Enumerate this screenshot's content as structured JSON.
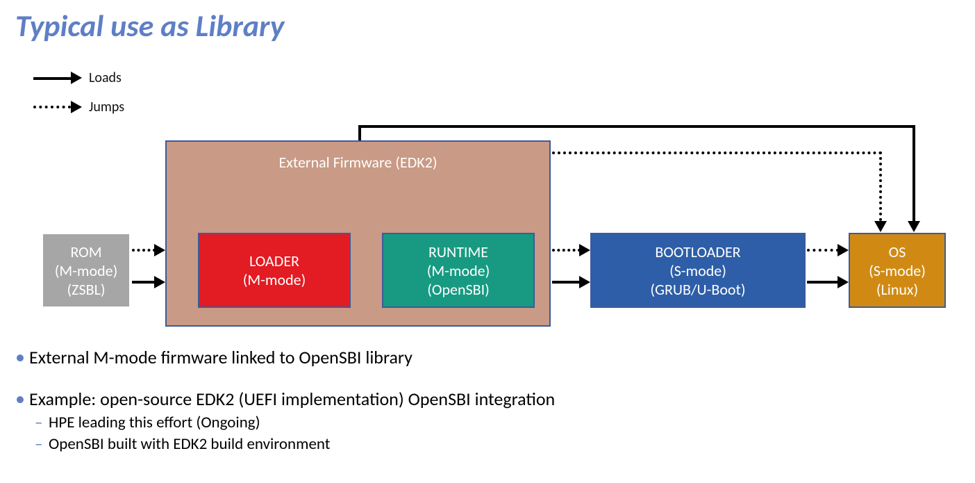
{
  "title": "Typical use as Library",
  "legend": {
    "loads": "Loads",
    "jumps": "Jumps"
  },
  "rom": {
    "l1": "ROM",
    "l2": "(M-mode)",
    "l3": "(ZSBL)"
  },
  "fw": {
    "l1": "External Firmware",
    "l2": "(EDK2)"
  },
  "loader": {
    "l1": "LOADER",
    "l2": "(M-mode)"
  },
  "runtime": {
    "l1": "RUNTIME",
    "l2": "(M-mode)",
    "l3": "(OpenSBI)"
  },
  "boot": {
    "l1": "BOOTLOADER",
    "l2": "(S-mode)",
    "l3": "(GRUB/U-Boot)"
  },
  "os": {
    "l1": "OS",
    "l2": "(S-mode)",
    "l3": "(Linux)"
  },
  "bullets": {
    "b1": "External M-mode firmware linked to OpenSBI library",
    "b2": "Example: open-source EDK2 (UEFI implementation) OpenSBI integration",
    "s1": "HPE leading this effort (Ongoing)",
    "s2": "OpenSBI built with EDK2 build environment"
  }
}
